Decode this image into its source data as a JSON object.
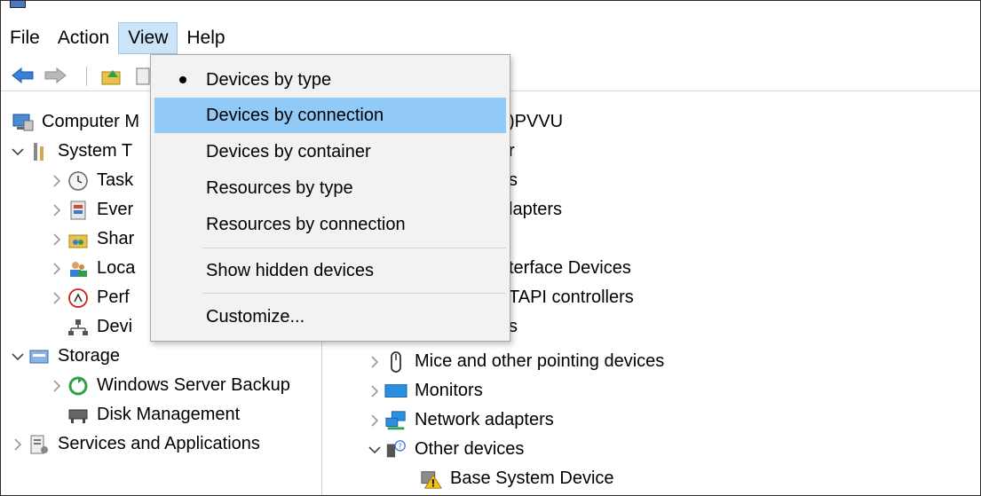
{
  "menubar": {
    "items": [
      "File",
      "Action",
      "View",
      "Help"
    ]
  },
  "view_menu": {
    "items": [
      {
        "label": "Devices by type",
        "checked": true
      },
      {
        "label": "Devices by connection",
        "highlighted": true
      },
      {
        "label": "Devices by container"
      },
      {
        "label": "Resources by type"
      },
      {
        "label": "Resources by connection"
      },
      {
        "label": "Show hidden devices"
      },
      {
        "label": "Customize..."
      }
    ]
  },
  "tree": {
    "root": "Computer M",
    "system_tools": "System T",
    "children": [
      "Task",
      "Ever",
      "Shar",
      "Loca",
      "Perf",
      "Devi"
    ],
    "storage": "Storage",
    "storage_children": [
      "Windows Server Backup",
      "Disk Management"
    ],
    "services": "Services and Applications"
  },
  "device_list": {
    "top_partials": [
      ")PVVU",
      "r",
      "s",
      "lapters",
      "",
      "terface Devices",
      "TAPI controllers",
      "s"
    ],
    "items": [
      {
        "label": "Mice and other pointing devices",
        "expanded": false
      },
      {
        "label": "Monitors",
        "expanded": false
      },
      {
        "label": "Network adapters",
        "expanded": false
      },
      {
        "label": "Other devices",
        "expanded": true
      }
    ],
    "child": "Base System Device"
  },
  "icons": {
    "back": "back-arrow-icon",
    "forward": "forward-arrow-icon",
    "folder": "folder-up-icon",
    "computer": "computer-management-icon"
  },
  "colors": {
    "menu_hover": "#91c9f7",
    "menubar_active": "#cce4f7"
  }
}
